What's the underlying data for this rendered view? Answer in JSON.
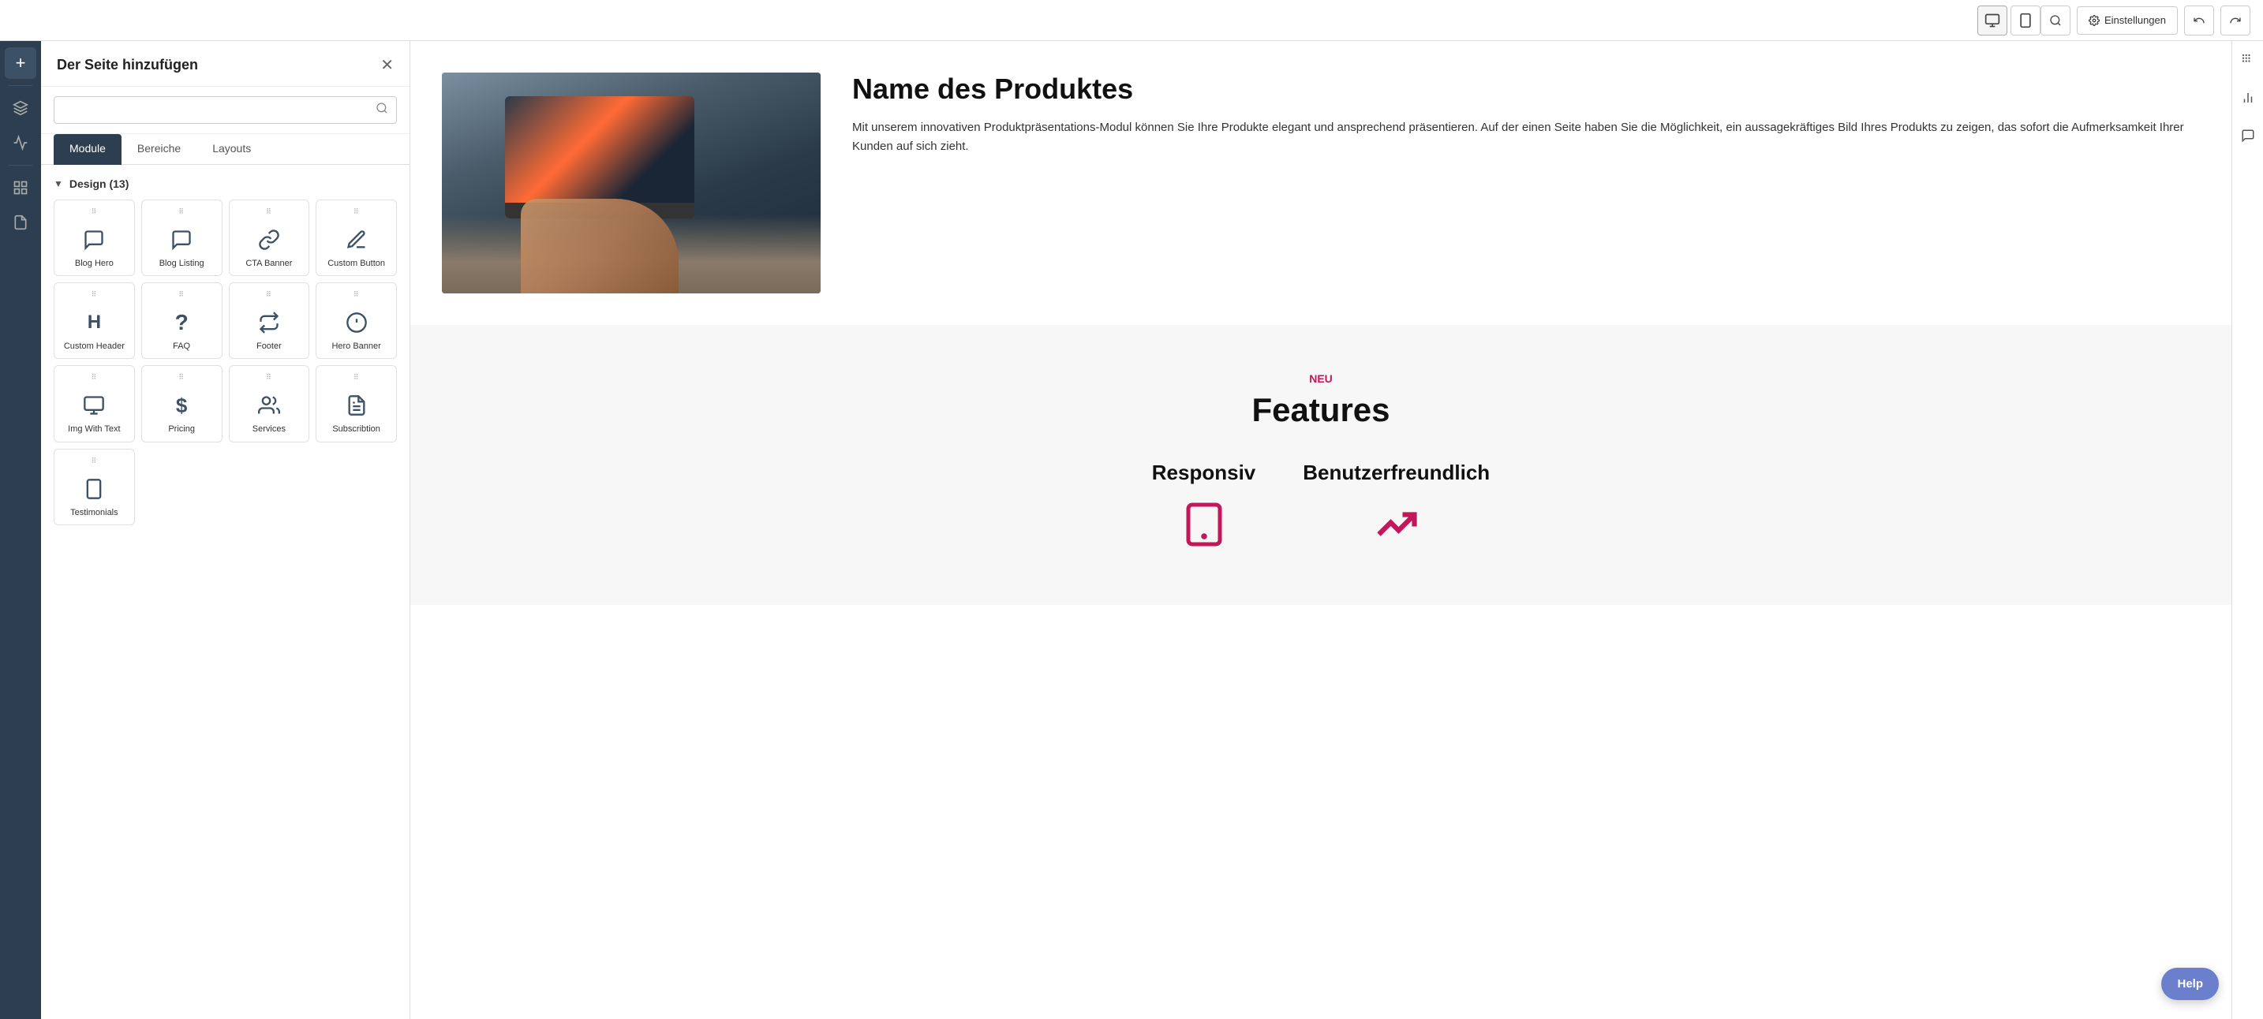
{
  "topbar": {
    "device_desktop_label": "🖥",
    "device_mobile_label": "📱",
    "search_label": "🔍",
    "settings_label": "Einstellungen",
    "undo_label": "↩",
    "redo_label": "↪"
  },
  "sidebar_thin": {
    "items": [
      {
        "name": "add",
        "icon": "+"
      },
      {
        "name": "layers",
        "icon": "⊞"
      },
      {
        "name": "analytics",
        "icon": "📈"
      },
      {
        "name": "elements",
        "icon": "⊡"
      },
      {
        "name": "pages",
        "icon": "📄"
      }
    ]
  },
  "add_panel": {
    "title": "Der Seite hinzufügen",
    "search_placeholder": "",
    "tabs": [
      "Module",
      "Bereiche",
      "Layouts"
    ],
    "active_tab": "Module",
    "section_label": "Design (13)",
    "modules": [
      {
        "id": "blog-hero",
        "label": "Blog Hero",
        "icon": "📡"
      },
      {
        "id": "blog-listing",
        "label": "Blog Listing",
        "icon": "📡"
      },
      {
        "id": "cta-banner",
        "label": "CTA Banner",
        "icon": "🔗"
      },
      {
        "id": "custom-button",
        "label": "Custom Button",
        "icon": "✏️"
      },
      {
        "id": "custom-header",
        "label": "Custom Header",
        "icon": "H"
      },
      {
        "id": "faq",
        "label": "FAQ",
        "icon": "?"
      },
      {
        "id": "footer",
        "label": "Footer",
        "icon": "⇌"
      },
      {
        "id": "hero-banner",
        "label": "Hero Banner",
        "icon": "🔰"
      },
      {
        "id": "img-with-text",
        "label": "Img With Text",
        "icon": "🖥"
      },
      {
        "id": "pricing",
        "label": "Pricing",
        "icon": "$"
      },
      {
        "id": "services",
        "label": "Services",
        "icon": "👥"
      },
      {
        "id": "subscribtion",
        "label": "Subscribtion",
        "icon": "📋"
      },
      {
        "id": "testimonials",
        "label": "Testimonials",
        "icon": "📱"
      }
    ]
  },
  "canvas": {
    "product": {
      "title": "Name des Produktes",
      "description": "Mit unserem innovativen Produktpräsentations-Modul können Sie Ihre Produkte elegant und ansprechend präsentieren. Auf der einen Seite haben Sie die Möglichkeit, ein aussagekräftiges Bild Ihres Produkts zu zeigen, das sofort die Aufmerksamkeit Ihrer Kunden auf sich zieht."
    },
    "features": {
      "label": "NEU",
      "title": "Features",
      "items": [
        {
          "name": "Responsiv",
          "icon": "tablet"
        },
        {
          "name": "Benutzerfreundlich",
          "icon": "chart"
        }
      ]
    }
  },
  "right_sidebar": {
    "items": [
      {
        "name": "grid",
        "icon": "⠿"
      },
      {
        "name": "bar-chart",
        "icon": "📊"
      },
      {
        "name": "chat",
        "icon": "💬"
      }
    ]
  },
  "help": {
    "label": "Help"
  }
}
